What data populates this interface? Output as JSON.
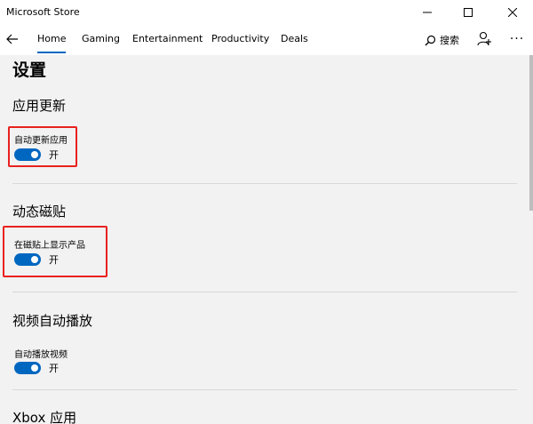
{
  "window": {
    "title": "Microsoft Store"
  },
  "nav": {
    "tabs": [
      {
        "label": "Home",
        "selected": true
      },
      {
        "label": "Gaming"
      },
      {
        "label": "Entertainment"
      },
      {
        "label": "Productivity"
      },
      {
        "label": "Deals"
      }
    ],
    "search_label": "搜索"
  },
  "page": {
    "title": "设置"
  },
  "sections": [
    {
      "title": "应用更新",
      "setting_label": "自动更新应用",
      "toggle_state": "开",
      "toggle_on": true,
      "highlighted": true
    },
    {
      "title": "动态磁贴",
      "setting_label": "在磁贴上显示产品",
      "toggle_state": "开",
      "toggle_on": true,
      "highlighted": true
    },
    {
      "title": "视频自动播放",
      "setting_label": "自动播放视频",
      "toggle_state": "开",
      "toggle_on": true,
      "highlighted": false
    },
    {
      "title": "Xbox 应用"
    }
  ],
  "colors": {
    "accent": "#0067c0",
    "highlight": "#e8211e",
    "background": "#f2f2f2"
  }
}
